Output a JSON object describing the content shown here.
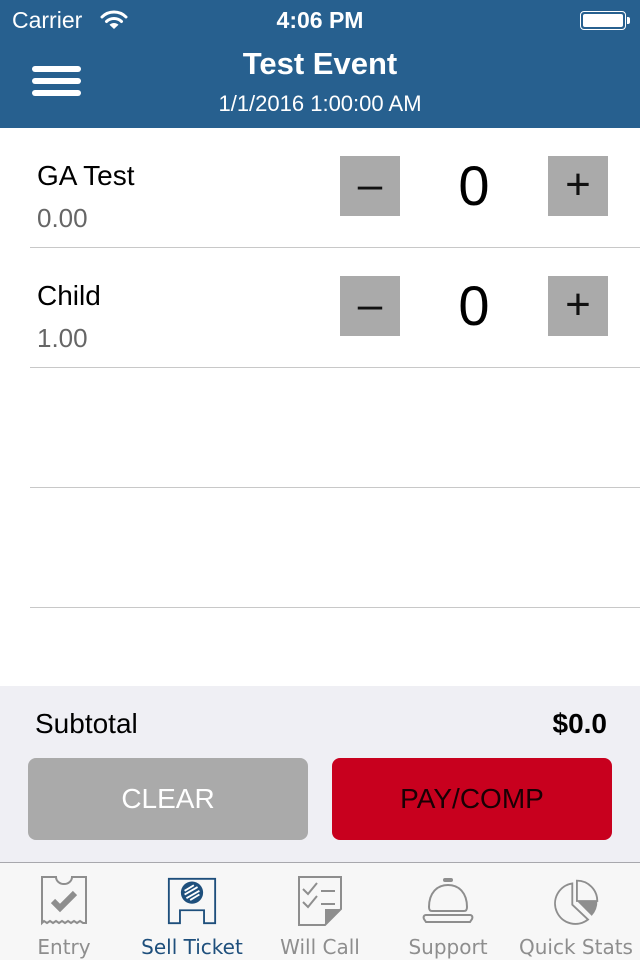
{
  "status_bar": {
    "carrier": "Carrier",
    "time": "4:06 PM",
    "battery_level": 1.0
  },
  "header": {
    "title": "Test Event",
    "subtitle": "1/1/2016 1:00:00 AM",
    "menu_icon": "hamburger-menu-icon"
  },
  "tickets": [
    {
      "name": "GA Test",
      "price": "0.00",
      "quantity": "0",
      "minus_label": "–",
      "plus_label": "+"
    },
    {
      "name": "Child",
      "price": "1.00",
      "quantity": "0",
      "minus_label": "–",
      "plus_label": "+"
    }
  ],
  "summary": {
    "subtotal_label": "Subtotal",
    "subtotal_value": "$0.0",
    "clear_label": "CLEAR",
    "pay_label": "PAY/COMP"
  },
  "colors": {
    "header": "#27608f",
    "pay_button": "#c8001e",
    "clear_button": "#aaaaaa",
    "active_tab": "#1e4f7c",
    "inactive_tab": "#8e8e8e"
  },
  "tabbar": {
    "active": "sell-ticket",
    "items": [
      {
        "id": "entry",
        "label": "Entry",
        "icon": "ticket-check-icon"
      },
      {
        "id": "sell-ticket",
        "label": "Sell Ticket",
        "icon": "sell-ticket-icon"
      },
      {
        "id": "will-call",
        "label": "Will Call",
        "icon": "checklist-icon"
      },
      {
        "id": "support",
        "label": "Support",
        "icon": "service-bell-icon"
      },
      {
        "id": "quick-stats",
        "label": "Quick Stats",
        "icon": "pie-chart-icon"
      }
    ]
  }
}
